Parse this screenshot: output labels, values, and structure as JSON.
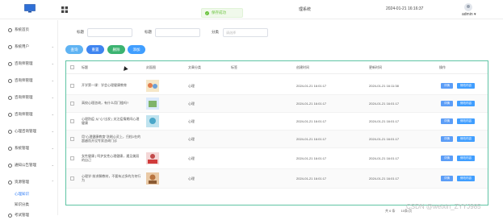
{
  "header": {
    "system_title": "理系统",
    "datetime": "2024-01-21 16:16:37",
    "username": "admin ▾",
    "toast": "保存成功"
  },
  "sidebar": {
    "items": [
      {
        "label": "系统首页"
      },
      {
        "label": "系统用户"
      },
      {
        "label": "咨询师管理"
      },
      {
        "label": "咨询师管理"
      },
      {
        "label": "咨询师管理"
      },
      {
        "label": "咨询师管理"
      },
      {
        "label": "心理咨询管理"
      },
      {
        "label": "系统管理"
      },
      {
        "label": "通知公告管理"
      },
      {
        "label": "资源管理"
      }
    ],
    "subitems": [
      {
        "label": "心理知识"
      },
      {
        "label": "知识分类"
      }
    ],
    "last_item": "考试管理"
  },
  "search": {
    "title_label": "标题",
    "cover_label": "标题",
    "category_label": "分类",
    "category_placeholder": "请选择"
  },
  "toolbar": {
    "search": "查询",
    "reset": "重置",
    "delete": "删除",
    "add": "添加"
  },
  "table": {
    "headers": [
      "标题",
      "封面图",
      "文章分类",
      "标签",
      "创建时间",
      "更新时间",
      "操作"
    ],
    "rows": [
      {
        "title": "开学第一课：学会心理健康教育",
        "category": "心理",
        "created": "2024-01-21 16:01:17",
        "updated": "2024-01-21 16:11:38",
        "detail": "详情",
        "edit": "修改内容"
      },
      {
        "title": "高校心理咨询，有什么用门槛吗?",
        "category": "心理",
        "created": "2024-01-21 16:01:17",
        "updated": "2024-01-21 16:01:17",
        "detail": "详情",
        "edit": "修改内容"
      },
      {
        "title": "心理防疫·从\"心\"出发 | 关注疫情期间心理健康",
        "category": "心理",
        "created": "2024-01-21 16:01:17",
        "updated": "2024-01-21 16:01:17",
        "detail": "详情",
        "edit": "修改内容"
      },
      {
        "title": "用\"心理健康教育\"洗刷心灵上，归档1在的超越而开设专家咨询门诊",
        "category": "心理",
        "created": "2024-01-21 16:01:17",
        "updated": "2024-01-21 16:01:17",
        "detail": "详情",
        "edit": "修改内容"
      },
      {
        "title": "女性健康 | 呵护女性心理健康，遇见美丽的自己",
        "category": "心理",
        "created": "2024-01-21 16:01:17",
        "updated": "2024-01-21 16:01:17",
        "detail": "详情",
        "edit": "修改内容"
      },
      {
        "title": "心理学·前求解教材，不要有过多的为何行为",
        "category": "心理",
        "created": "2024-01-21 16:01:17",
        "updated": "2024-01-21 16:01:17",
        "detail": "详情",
        "edit": "修改内容"
      }
    ]
  },
  "pager": {
    "total": "共 6 条",
    "per_page": "10条/页"
  },
  "watermark": "CSDN @weixin_ZYYJ985",
  "colors": {
    "accent": "#409eff",
    "detail": "#5b9df7",
    "delete": "#3cb371",
    "table_border": "#5fc4a4"
  }
}
